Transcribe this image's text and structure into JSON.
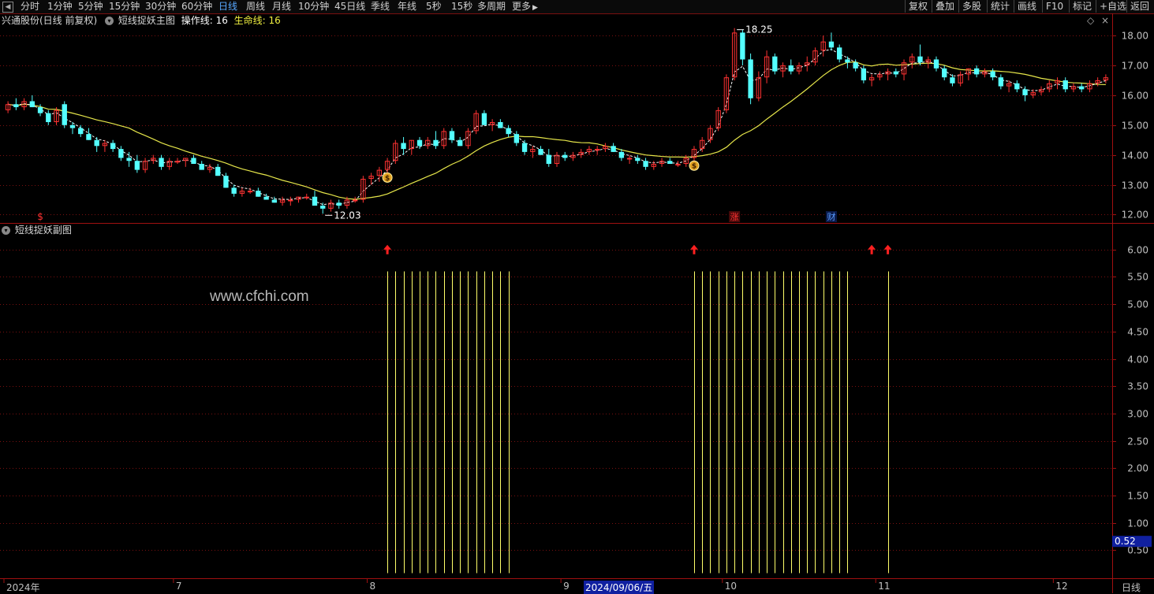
{
  "toolbar": {
    "periods": [
      {
        "label": "分时",
        "active": false
      },
      {
        "label": "1分钟",
        "active": false
      },
      {
        "label": "5分钟",
        "active": false
      },
      {
        "label": "15分钟",
        "active": false
      },
      {
        "label": "30分钟",
        "active": false
      },
      {
        "label": "60分钟",
        "active": false
      },
      {
        "label": "日线",
        "active": true
      },
      {
        "label": "周线",
        "active": false
      },
      {
        "label": "月线",
        "active": false
      },
      {
        "label": "10分钟",
        "active": false
      },
      {
        "label": "45日线",
        "active": false
      },
      {
        "label": "季线",
        "active": false
      },
      {
        "label": "年线",
        "active": false
      },
      {
        "label": "5秒",
        "active": false
      },
      {
        "label": "15秒",
        "active": false
      },
      {
        "label": "多周期",
        "active": false
      }
    ],
    "more_label": "更多",
    "right_buttons": [
      "复权",
      "叠加",
      "多股",
      "统计",
      "画线",
      "F10",
      "标记",
      "+自选",
      "返回"
    ]
  },
  "main_header": {
    "stock": "兴通股份(日线 前复权)",
    "indicator": "短线捉妖主图",
    "op_line_label": "操作线:",
    "op_line_value": "16",
    "life_line_label": "生命线:",
    "life_line_value": "16"
  },
  "sub_header": {
    "indicator": "短线捉妖副图"
  },
  "watermark": "www.cfchi.com",
  "colors": {
    "up": "#ff3232",
    "down": "#54ffff",
    "ma": "#e6e64a",
    "grid": "#7a1010",
    "arrow": "#ff2020",
    "bar": "#ffff6a",
    "axis_text": "#c0c0c0",
    "active_tab": "#58a8ff"
  },
  "chart_data": [
    {
      "type": "candlestick",
      "title": "兴通股份(日线 前复权)",
      "y_ticks": [
        "18.00",
        "17.00",
        "16.00",
        "15.00",
        "14.00",
        "13.00",
        "12.00"
      ],
      "ylim": [
        11.8,
        18.4
      ],
      "annotations": {
        "high_label": "18.25",
        "low_label": "12.03"
      },
      "event_markers": [
        {
          "label": "$",
          "x_index": 4,
          "color": "#ff3232"
        },
        {
          "label": "涨",
          "x_index": 90,
          "color": "#ff3232"
        },
        {
          "label": "财",
          "x_index": 102,
          "color": "#5a9bff"
        }
      ],
      "buy_signals": [
        47,
        85
      ],
      "series_ma_name": "生命线",
      "ohlc": [
        [
          15.5,
          15.8,
          15.4,
          15.7
        ],
        [
          15.7,
          15.9,
          15.5,
          15.6
        ],
        [
          15.6,
          15.9,
          15.5,
          15.8
        ],
        [
          15.8,
          16.0,
          15.6,
          15.6
        ],
        [
          15.6,
          15.7,
          15.3,
          15.4
        ],
        [
          15.4,
          15.5,
          15.0,
          15.1
        ],
        [
          15.1,
          15.6,
          15.0,
          15.5
        ],
        [
          15.7,
          15.8,
          14.9,
          15.0
        ],
        [
          15.0,
          15.1,
          14.7,
          14.9
        ],
        [
          14.9,
          15.0,
          14.6,
          14.7
        ],
        [
          14.7,
          14.9,
          14.5,
          14.5
        ],
        [
          14.5,
          14.6,
          14.1,
          14.3
        ],
        [
          14.3,
          14.5,
          14.1,
          14.4
        ],
        [
          14.4,
          14.5,
          14.1,
          14.2
        ],
        [
          14.2,
          14.3,
          13.8,
          13.9
        ],
        [
          13.9,
          14.1,
          13.6,
          13.8
        ],
        [
          13.8,
          14.0,
          13.4,
          13.5
        ],
        [
          13.5,
          13.9,
          13.4,
          13.8
        ],
        [
          13.8,
          14.0,
          13.7,
          13.9
        ],
        [
          13.9,
          14.0,
          13.5,
          13.6
        ],
        [
          13.6,
          13.9,
          13.5,
          13.8
        ],
        [
          13.8,
          13.9,
          13.7,
          13.8
        ],
        [
          13.8,
          13.9,
          13.6,
          13.9
        ],
        [
          13.9,
          14.0,
          13.7,
          13.7
        ],
        [
          13.7,
          13.8,
          13.5,
          13.5
        ],
        [
          13.5,
          13.7,
          13.4,
          13.6
        ],
        [
          13.6,
          13.7,
          13.3,
          13.3
        ],
        [
          13.3,
          13.4,
          12.9,
          12.9
        ],
        [
          12.9,
          13.0,
          12.6,
          12.7
        ],
        [
          12.7,
          12.9,
          12.6,
          12.8
        ],
        [
          12.8,
          12.9,
          12.7,
          12.8
        ],
        [
          12.8,
          12.9,
          12.6,
          12.6
        ],
        [
          12.6,
          12.7,
          12.5,
          12.5
        ],
        [
          12.5,
          12.6,
          12.4,
          12.4
        ],
        [
          12.4,
          12.6,
          12.3,
          12.5
        ],
        [
          12.5,
          12.6,
          12.3,
          12.5
        ],
        [
          12.5,
          12.6,
          12.4,
          12.6
        ],
        [
          12.6,
          12.7,
          12.5,
          12.6
        ],
        [
          12.6,
          12.8,
          12.5,
          12.3
        ],
        [
          12.3,
          12.4,
          12.03,
          12.2
        ],
        [
          12.2,
          12.5,
          12.1,
          12.4
        ],
        [
          12.4,
          12.5,
          12.2,
          12.3
        ],
        [
          12.3,
          12.6,
          12.2,
          12.5
        ],
        [
          12.5,
          12.6,
          12.4,
          12.5
        ],
        [
          12.5,
          13.3,
          12.4,
          13.2
        ],
        [
          13.2,
          13.4,
          13.0,
          13.3
        ],
        [
          13.3,
          13.6,
          13.1,
          13.5
        ],
        [
          13.5,
          13.9,
          13.4,
          13.8
        ],
        [
          13.8,
          14.5,
          13.7,
          14.4
        ],
        [
          14.4,
          14.6,
          14.0,
          14.2
        ],
        [
          14.2,
          14.5,
          14.0,
          14.5
        ],
        [
          14.5,
          14.6,
          14.2,
          14.3
        ],
        [
          14.3,
          14.6,
          14.2,
          14.5
        ],
        [
          14.5,
          14.8,
          14.2,
          14.3
        ],
        [
          14.3,
          14.9,
          14.2,
          14.8
        ],
        [
          14.8,
          14.9,
          14.4,
          14.5
        ],
        [
          14.5,
          14.6,
          14.3,
          14.3
        ],
        [
          14.3,
          14.9,
          14.2,
          14.8
        ],
        [
          14.8,
          15.5,
          14.7,
          15.4
        ],
        [
          15.4,
          15.5,
          15.0,
          15.0
        ],
        [
          15.0,
          15.2,
          14.8,
          15.1
        ],
        [
          15.1,
          15.2,
          14.9,
          14.9
        ],
        [
          14.9,
          15.0,
          14.6,
          14.7
        ],
        [
          14.7,
          14.8,
          14.3,
          14.4
        ],
        [
          14.4,
          14.5,
          14.0,
          14.1
        ],
        [
          14.1,
          14.3,
          13.9,
          14.2
        ],
        [
          14.2,
          14.3,
          14.0,
          14.0
        ],
        [
          14.0,
          14.2,
          13.6,
          13.7
        ],
        [
          13.7,
          14.1,
          13.6,
          14.0
        ],
        [
          14.0,
          14.1,
          13.8,
          13.9
        ],
        [
          13.9,
          14.1,
          13.8,
          14.0
        ],
        [
          14.0,
          14.2,
          13.9,
          14.1
        ],
        [
          14.1,
          14.3,
          14.0,
          14.2
        ],
        [
          14.2,
          14.3,
          14.0,
          14.2
        ],
        [
          14.2,
          14.4,
          14.1,
          14.3
        ],
        [
          14.3,
          14.4,
          14.1,
          14.1
        ],
        [
          14.1,
          14.2,
          13.8,
          13.9
        ],
        [
          13.9,
          14.0,
          13.7,
          13.9
        ],
        [
          13.9,
          14.0,
          13.7,
          13.8
        ],
        [
          13.8,
          13.9,
          13.5,
          13.6
        ],
        [
          13.6,
          13.8,
          13.5,
          13.7
        ],
        [
          13.7,
          13.9,
          13.6,
          13.8
        ],
        [
          13.8,
          13.9,
          13.7,
          13.7
        ],
        [
          13.7,
          13.8,
          13.6,
          13.7
        ],
        [
          13.7,
          14.0,
          13.6,
          13.9
        ],
        [
          13.9,
          14.3,
          13.8,
          14.2
        ],
        [
          14.2,
          14.6,
          14.1,
          14.5
        ],
        [
          14.5,
          15.0,
          14.4,
          14.9
        ],
        [
          14.9,
          15.6,
          14.8,
          15.5
        ],
        [
          15.5,
          16.7,
          15.4,
          16.6
        ],
        [
          16.6,
          18.25,
          16.5,
          18.1
        ],
        [
          18.1,
          18.2,
          17.0,
          17.2
        ],
        [
          17.2,
          17.4,
          15.7,
          15.9
        ],
        [
          15.9,
          16.8,
          15.8,
          16.6
        ],
        [
          16.6,
          17.5,
          16.4,
          17.3
        ],
        [
          17.3,
          17.4,
          16.7,
          16.8
        ],
        [
          16.8,
          17.1,
          16.6,
          17.0
        ],
        [
          17.0,
          17.2,
          16.7,
          16.8
        ],
        [
          16.8,
          17.1,
          16.7,
          17.0
        ],
        [
          17.0,
          17.3,
          16.8,
          17.1
        ],
        [
          17.1,
          17.6,
          17.0,
          17.5
        ],
        [
          17.5,
          18.0,
          17.3,
          17.8
        ],
        [
          17.8,
          18.1,
          17.5,
          17.6
        ],
        [
          17.6,
          17.7,
          17.1,
          17.2
        ],
        [
          17.2,
          17.3,
          16.9,
          17.1
        ],
        [
          17.1,
          17.2,
          16.8,
          16.9
        ],
        [
          16.9,
          17.0,
          16.4,
          16.5
        ],
        [
          16.5,
          16.7,
          16.3,
          16.6
        ],
        [
          16.6,
          16.8,
          16.5,
          16.7
        ],
        [
          16.7,
          16.9,
          16.5,
          16.8
        ],
        [
          16.8,
          16.9,
          16.6,
          16.7
        ],
        [
          16.7,
          17.2,
          16.5,
          17.1
        ],
        [
          17.1,
          17.4,
          16.9,
          17.3
        ],
        [
          17.3,
          17.7,
          17.0,
          17.1
        ],
        [
          17.1,
          17.3,
          16.9,
          17.2
        ],
        [
          17.2,
          17.3,
          16.8,
          16.9
        ],
        [
          16.9,
          17.0,
          16.5,
          16.6
        ],
        [
          16.6,
          16.7,
          16.3,
          16.4
        ],
        [
          16.4,
          16.8,
          16.3,
          16.7
        ],
        [
          16.7,
          16.9,
          16.5,
          16.9
        ],
        [
          16.9,
          17.0,
          16.6,
          16.7
        ],
        [
          16.7,
          16.9,
          16.6,
          16.8
        ],
        [
          16.8,
          16.9,
          16.5,
          16.6
        ],
        [
          16.6,
          16.7,
          16.2,
          16.3
        ],
        [
          16.3,
          16.5,
          16.1,
          16.4
        ],
        [
          16.4,
          16.5,
          16.1,
          16.2
        ],
        [
          16.2,
          16.3,
          15.8,
          16.0
        ],
        [
          16.0,
          16.2,
          15.9,
          16.1
        ],
        [
          16.1,
          16.3,
          16.0,
          16.2
        ],
        [
          16.2,
          16.5,
          16.1,
          16.4
        ],
        [
          16.4,
          16.6,
          16.2,
          16.5
        ],
        [
          16.5,
          16.6,
          16.1,
          16.2
        ],
        [
          16.2,
          16.4,
          16.1,
          16.3
        ],
        [
          16.3,
          16.4,
          16.1,
          16.2
        ],
        [
          16.2,
          16.5,
          16.1,
          16.4
        ],
        [
          16.4,
          16.6,
          16.3,
          16.5
        ],
        [
          16.5,
          16.7,
          16.4,
          16.6
        ]
      ]
    },
    {
      "type": "bar",
      "title": "短线捉妖副图",
      "y_ticks": [
        "6.00",
        "5.50",
        "5.00",
        "4.50",
        "4.00",
        "3.50",
        "3.00",
        "2.50",
        "2.00",
        "1.50",
        "1.00",
        "0.50"
      ],
      "ylim": [
        0,
        6.3
      ],
      "bar_value": 5.6,
      "current_value_label": "0.52",
      "signal_bars": [
        47,
        48,
        49,
        50,
        51,
        52,
        53,
        54,
        55,
        56,
        57,
        58,
        59,
        60,
        61,
        62,
        85,
        86,
        87,
        88,
        89,
        90,
        91,
        92,
        93,
        94,
        95,
        96,
        97,
        98,
        99,
        100,
        101,
        102,
        103,
        104,
        109
      ],
      "arrows": [
        47,
        85,
        107,
        109
      ]
    }
  ],
  "x_axis": {
    "labels": [
      {
        "text": "2024年",
        "x_index": 0
      },
      {
        "text": "7",
        "x_index": 21
      },
      {
        "text": "8",
        "x_index": 45
      },
      {
        "text": "9",
        "x_index": 69
      },
      {
        "text": "10",
        "x_index": 89
      },
      {
        "text": "11",
        "x_index": 108
      },
      {
        "text": "12",
        "x_index": 130
      }
    ],
    "cursor_date": "2024/09/06/五",
    "period_label": "日线"
  }
}
